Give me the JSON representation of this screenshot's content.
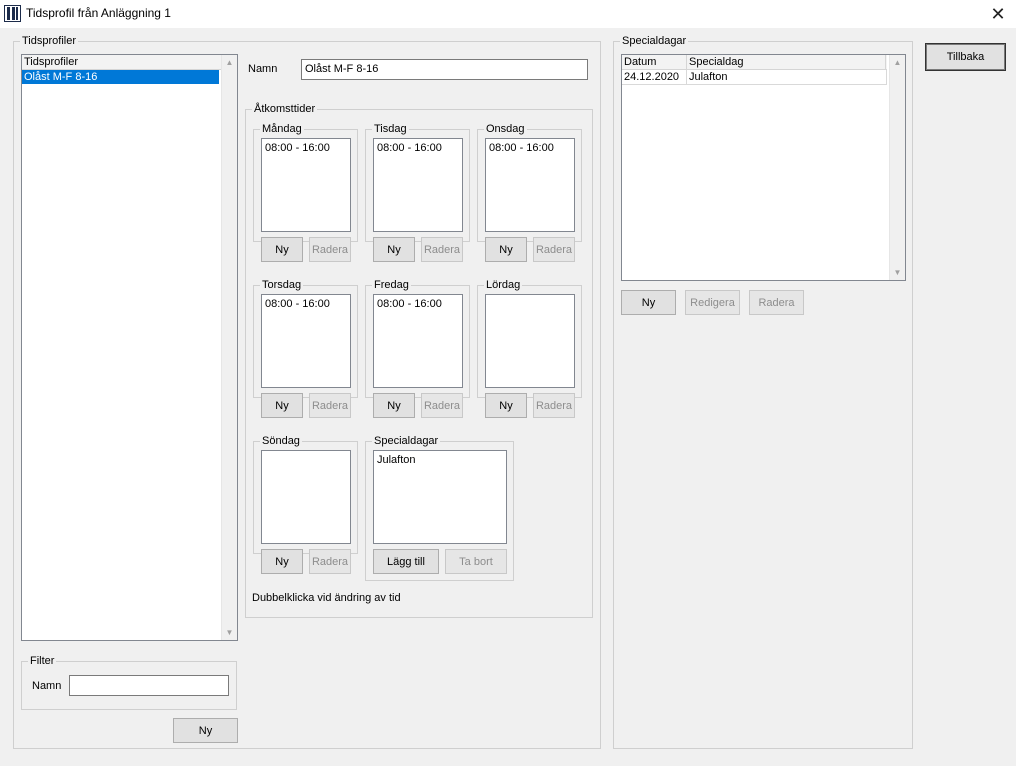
{
  "window": {
    "title": "Tidsprofil från Anläggning 1",
    "close_glyph": "✕",
    "icon": "app-logo-icon"
  },
  "left": {
    "group_label": "Tidsprofiler",
    "list_header": "Tidsprofiler",
    "items": [
      "Olåst M-F 8-16"
    ],
    "selected_index": 0,
    "filter": {
      "group_label": "Filter",
      "name_label": "Namn",
      "name_value": ""
    },
    "new_label": "Ny"
  },
  "profile": {
    "name_label": "Namn",
    "name_value": "Olåst M-F 8-16",
    "access_group_label": "Åtkomsttider",
    "days": [
      {
        "label": "Måndag",
        "entries": [
          "08:00 - 16:00"
        ],
        "new_label": "Ny",
        "delete_label": "Radera"
      },
      {
        "label": "Tisdag",
        "entries": [
          "08:00 - 16:00"
        ],
        "new_label": "Ny",
        "delete_label": "Radera"
      },
      {
        "label": "Onsdag",
        "entries": [
          "08:00 - 16:00"
        ],
        "new_label": "Ny",
        "delete_label": "Radera"
      },
      {
        "label": "Torsdag",
        "entries": [
          "08:00 - 16:00"
        ],
        "new_label": "Ny",
        "delete_label": "Radera"
      },
      {
        "label": "Fredag",
        "entries": [
          "08:00 - 16:00"
        ],
        "new_label": "Ny",
        "delete_label": "Radera"
      },
      {
        "label": "Lördag",
        "entries": [],
        "new_label": "Ny",
        "delete_label": "Radera"
      },
      {
        "label": "Söndag",
        "entries": [],
        "new_label": "Ny",
        "delete_label": "Radera"
      }
    ],
    "special": {
      "label": "Specialdagar",
      "entries": [
        "Julafton"
      ],
      "add_label": "Lägg till",
      "remove_label": "Ta bort"
    },
    "hint": "Dubbelklicka vid ändring av tid"
  },
  "specialdays": {
    "group_label": "Specialdagar",
    "columns": [
      "Datum",
      "Specialdag"
    ],
    "rows": [
      [
        "24.12.2020",
        "Julafton"
      ]
    ],
    "new_label": "Ny",
    "edit_label": "Redigera",
    "delete_label": "Radera"
  },
  "back_label": "Tillbaka"
}
